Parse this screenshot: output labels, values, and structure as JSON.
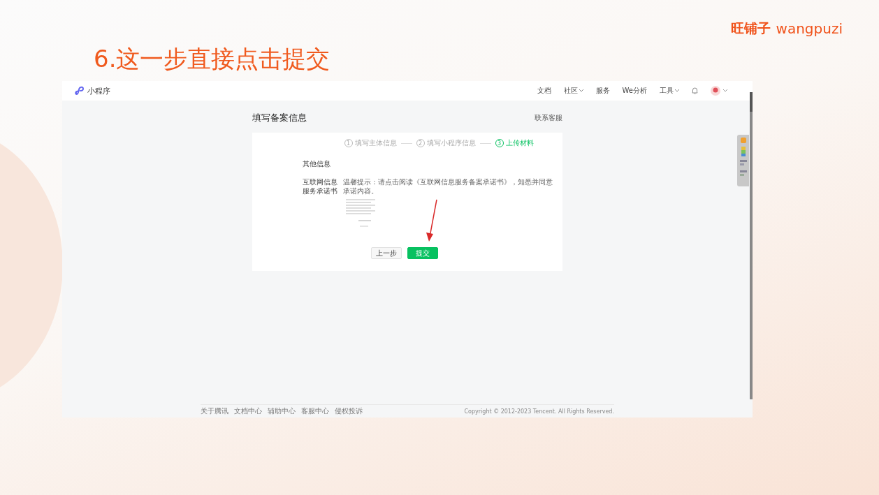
{
  "slide": {
    "title": "6.这一步直接点击提交",
    "brand": {
      "cn": "旺铺子",
      "en": "wangpuzi"
    }
  },
  "navbar": {
    "product": "小程序",
    "items": [
      {
        "label": "文档",
        "dropdown": false
      },
      {
        "label": "社区",
        "dropdown": true
      },
      {
        "label": "服务",
        "dropdown": false
      },
      {
        "label": "We分析",
        "dropdown": false
      },
      {
        "label": "工具",
        "dropdown": true
      }
    ]
  },
  "page": {
    "title": "填写备案信息",
    "help_link": "联系客服",
    "steps": [
      {
        "number": "1",
        "label": "填写主体信息",
        "selected": false
      },
      {
        "number": "2",
        "label": "填写小程序信息",
        "selected": false
      },
      {
        "number": "3",
        "label": "上传材料",
        "selected": true
      }
    ],
    "section_title": "其他信息",
    "field_label": "互联网信息服务承诺书",
    "hint": "温馨提示：请点击阅读《互联网信息服务备案承诺书》，知悉并同意承诺内容。",
    "buttons": [
      {
        "label": "上一步",
        "kind": "secondary"
      },
      {
        "label": "提交",
        "kind": "primary"
      }
    ]
  },
  "footer": {
    "links": [
      "关于腾讯",
      "文档中心",
      "辅助中心",
      "客服中心",
      "侵权投诉"
    ],
    "copyright": "Copyright © 2012-2023 Tencent. All Rights Reserved."
  }
}
